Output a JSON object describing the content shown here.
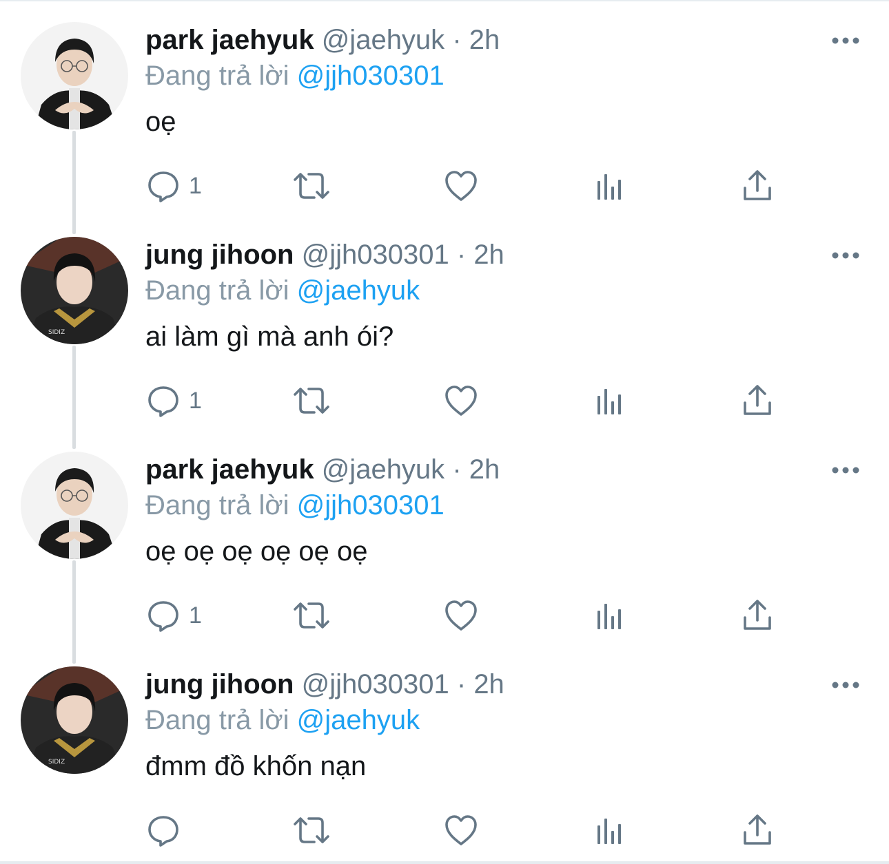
{
  "tweets": [
    {
      "name": "park jaehyuk",
      "handle": "@jaehyuk",
      "sep": "·",
      "time": "2h",
      "reply_prefix": "Đang trả lời",
      "reply_to": "@jjh030301",
      "text": "oẹ",
      "reply_count": "1",
      "avatar": "avatar-jaehyuk"
    },
    {
      "name": "jung jihoon",
      "handle": "@jjh030301",
      "sep": "·",
      "time": "2h",
      "reply_prefix": "Đang trả lời",
      "reply_to": "@jaehyuk",
      "text": "ai làm gì mà anh ói?",
      "reply_count": "1",
      "avatar": "avatar-jihoon",
      "avatar_jersey_text": "SIDIZ"
    },
    {
      "name": "park jaehyuk",
      "handle": "@jaehyuk",
      "sep": "·",
      "time": "2h",
      "reply_prefix": "Đang trả lời",
      "reply_to": "@jjh030301",
      "text": "oẹ oẹ oẹ oẹ oẹ oẹ",
      "reply_count": "1",
      "avatar": "avatar-jaehyuk"
    },
    {
      "name": "jung jihoon",
      "handle": "@jjh030301",
      "sep": "·",
      "time": "2h",
      "reply_prefix": "Đang trả lời",
      "reply_to": "@jaehyuk",
      "text": "đmm đồ khốn nạn",
      "reply_count": "",
      "avatar": "avatar-jihoon",
      "avatar_jersey_text": "SIDIZ"
    }
  ],
  "icons": {
    "more": "more-horizontal-icon",
    "reply": "reply-bubble-icon",
    "retweet": "retweet-icon",
    "like": "heart-icon",
    "analytics": "analytics-bars-icon",
    "share": "share-upload-icon"
  },
  "colors": {
    "name": "#14171a",
    "secondary": "#657786",
    "mention": "#1da1f2",
    "icon": "#657786",
    "thread_line": "#d9dde0"
  }
}
